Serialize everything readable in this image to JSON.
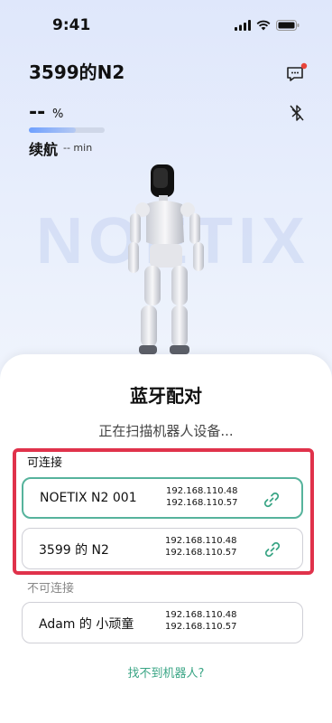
{
  "status": {
    "time": "9:41"
  },
  "header": {
    "title": "3599的N2"
  },
  "battery": {
    "value": "--",
    "unit": "%",
    "level": 0.62
  },
  "range": {
    "label": "续航",
    "value": "-- min"
  },
  "brand": {
    "watermark": "NOETIX"
  },
  "sheet": {
    "title": "蓝牙配对",
    "scanning": "正在扫描机器人设备...",
    "connectable_label": "可连接",
    "unavailable_label": "不可连接",
    "help": "找不到机器人?"
  },
  "devices_connectable": [
    {
      "name": "NOETIX N2 001",
      "ip1": "192.168.110.48",
      "ip2": "192.168.110.57",
      "selected": true
    },
    {
      "name": "3599 的 N2",
      "ip1": "192.168.110.48",
      "ip2": "192.168.110.57",
      "selected": false
    }
  ],
  "devices_unavailable": [
    {
      "name": "Adam 的 小顽童",
      "ip1": "192.168.110.48",
      "ip2": "192.168.110.57"
    }
  ],
  "colors": {
    "accent": "#3aa585",
    "highlight": "#e0324b",
    "notification": "#e8443a"
  }
}
